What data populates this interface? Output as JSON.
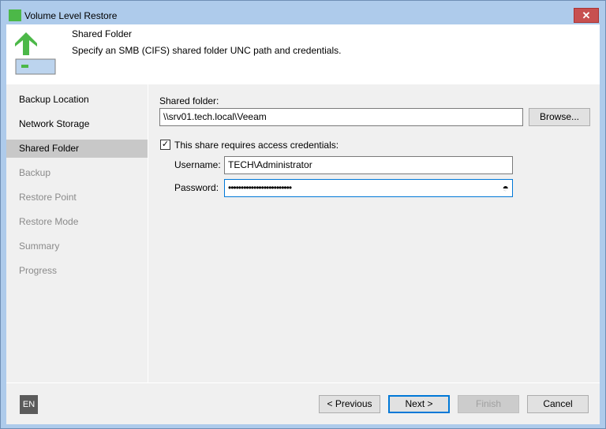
{
  "window": {
    "title": "Volume Level Restore",
    "close": "✕"
  },
  "header": {
    "title": "Shared Folder",
    "description": "Specify an SMB (CIFS) shared folder UNC path and credentials."
  },
  "nav": {
    "items": [
      {
        "label": "Backup Location"
      },
      {
        "label": "Network Storage"
      },
      {
        "label": "Shared Folder"
      },
      {
        "label": "Backup"
      },
      {
        "label": "Restore Point"
      },
      {
        "label": "Restore Mode"
      },
      {
        "label": "Summary"
      },
      {
        "label": "Progress"
      }
    ]
  },
  "form": {
    "shared_folder_label": "Shared folder:",
    "shared_folder_value": "\\\\srv01.tech.local\\Veeam",
    "browse": "Browse...",
    "credentials_checkbox": "This share requires access credentials:",
    "credentials_checked": true,
    "check_mark": "✓",
    "username_label": "Username:",
    "username_value": "TECH\\Administrator",
    "password_label": "Password:",
    "password_value": "•••••••••••••••••••••••••"
  },
  "footer": {
    "language": "EN",
    "previous": "< Previous",
    "next": "Next >",
    "finish": "Finish",
    "cancel": "Cancel"
  }
}
